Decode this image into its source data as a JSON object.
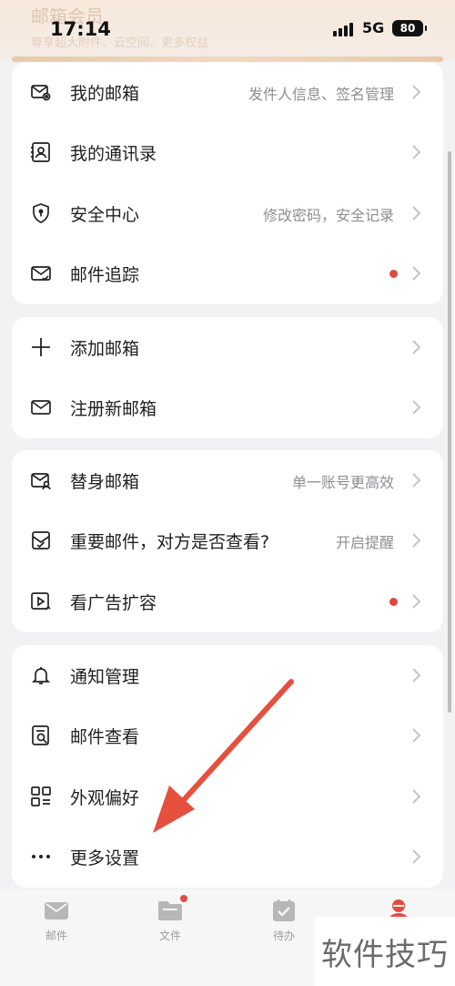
{
  "status_bar": {
    "time": "17:14",
    "network": "5G",
    "battery": "80"
  },
  "header_faded": {
    "title": "邮箱会员",
    "subtitle": "尊享超大附件、云空间、更多权益"
  },
  "groups": [
    {
      "items": [
        {
          "label": "我的邮箱",
          "hint": "发件人信息、签名管理",
          "dot": false,
          "icon": "mailbox-settings-icon"
        },
        {
          "label": "我的通讯录",
          "hint": "",
          "dot": false,
          "icon": "contacts-icon"
        },
        {
          "label": "安全中心",
          "hint": "修改密码，安全记录",
          "dot": false,
          "icon": "shield-icon"
        },
        {
          "label": "邮件追踪",
          "hint": "",
          "dot": true,
          "icon": "mail-track-icon"
        }
      ]
    },
    {
      "items": [
        {
          "label": "添加邮箱",
          "hint": "",
          "dot": false,
          "icon": "plus-icon"
        },
        {
          "label": "注册新邮箱",
          "hint": "",
          "dot": false,
          "icon": "envelope-icon"
        }
      ]
    },
    {
      "items": [
        {
          "label": "替身邮箱",
          "hint": "单一账号更高效",
          "dot": false,
          "icon": "alias-mail-icon"
        },
        {
          "label": "重要邮件，对方是否查看?",
          "hint": "开启提醒",
          "dot": false,
          "icon": "read-receipt-icon"
        },
        {
          "label": "看广告扩容",
          "hint": "",
          "dot": true,
          "icon": "video-ad-icon"
        }
      ]
    },
    {
      "items": [
        {
          "label": "通知管理",
          "hint": "",
          "dot": false,
          "icon": "bell-icon"
        },
        {
          "label": "邮件查看",
          "hint": "",
          "dot": false,
          "icon": "mail-view-icon"
        },
        {
          "label": "外观偏好",
          "hint": "",
          "dot": false,
          "icon": "appearance-icon"
        },
        {
          "label": "更多设置",
          "hint": "",
          "dot": false,
          "icon": "more-dots-icon"
        }
      ]
    }
  ],
  "tab_bar": {
    "tabs": [
      {
        "label": "邮件",
        "icon": "mail-tab-icon"
      },
      {
        "label": "文件",
        "icon": "folder-tab-icon"
      },
      {
        "label": "待办",
        "icon": "todo-tab-icon"
      },
      {
        "label": "",
        "icon": "profile-tab-icon"
      }
    ]
  },
  "watermark": "软件技巧",
  "colors": {
    "accent_red": "#e0473d",
    "annotation_arrow": "#e5503f",
    "gold_strip": "#e9c9a8"
  }
}
